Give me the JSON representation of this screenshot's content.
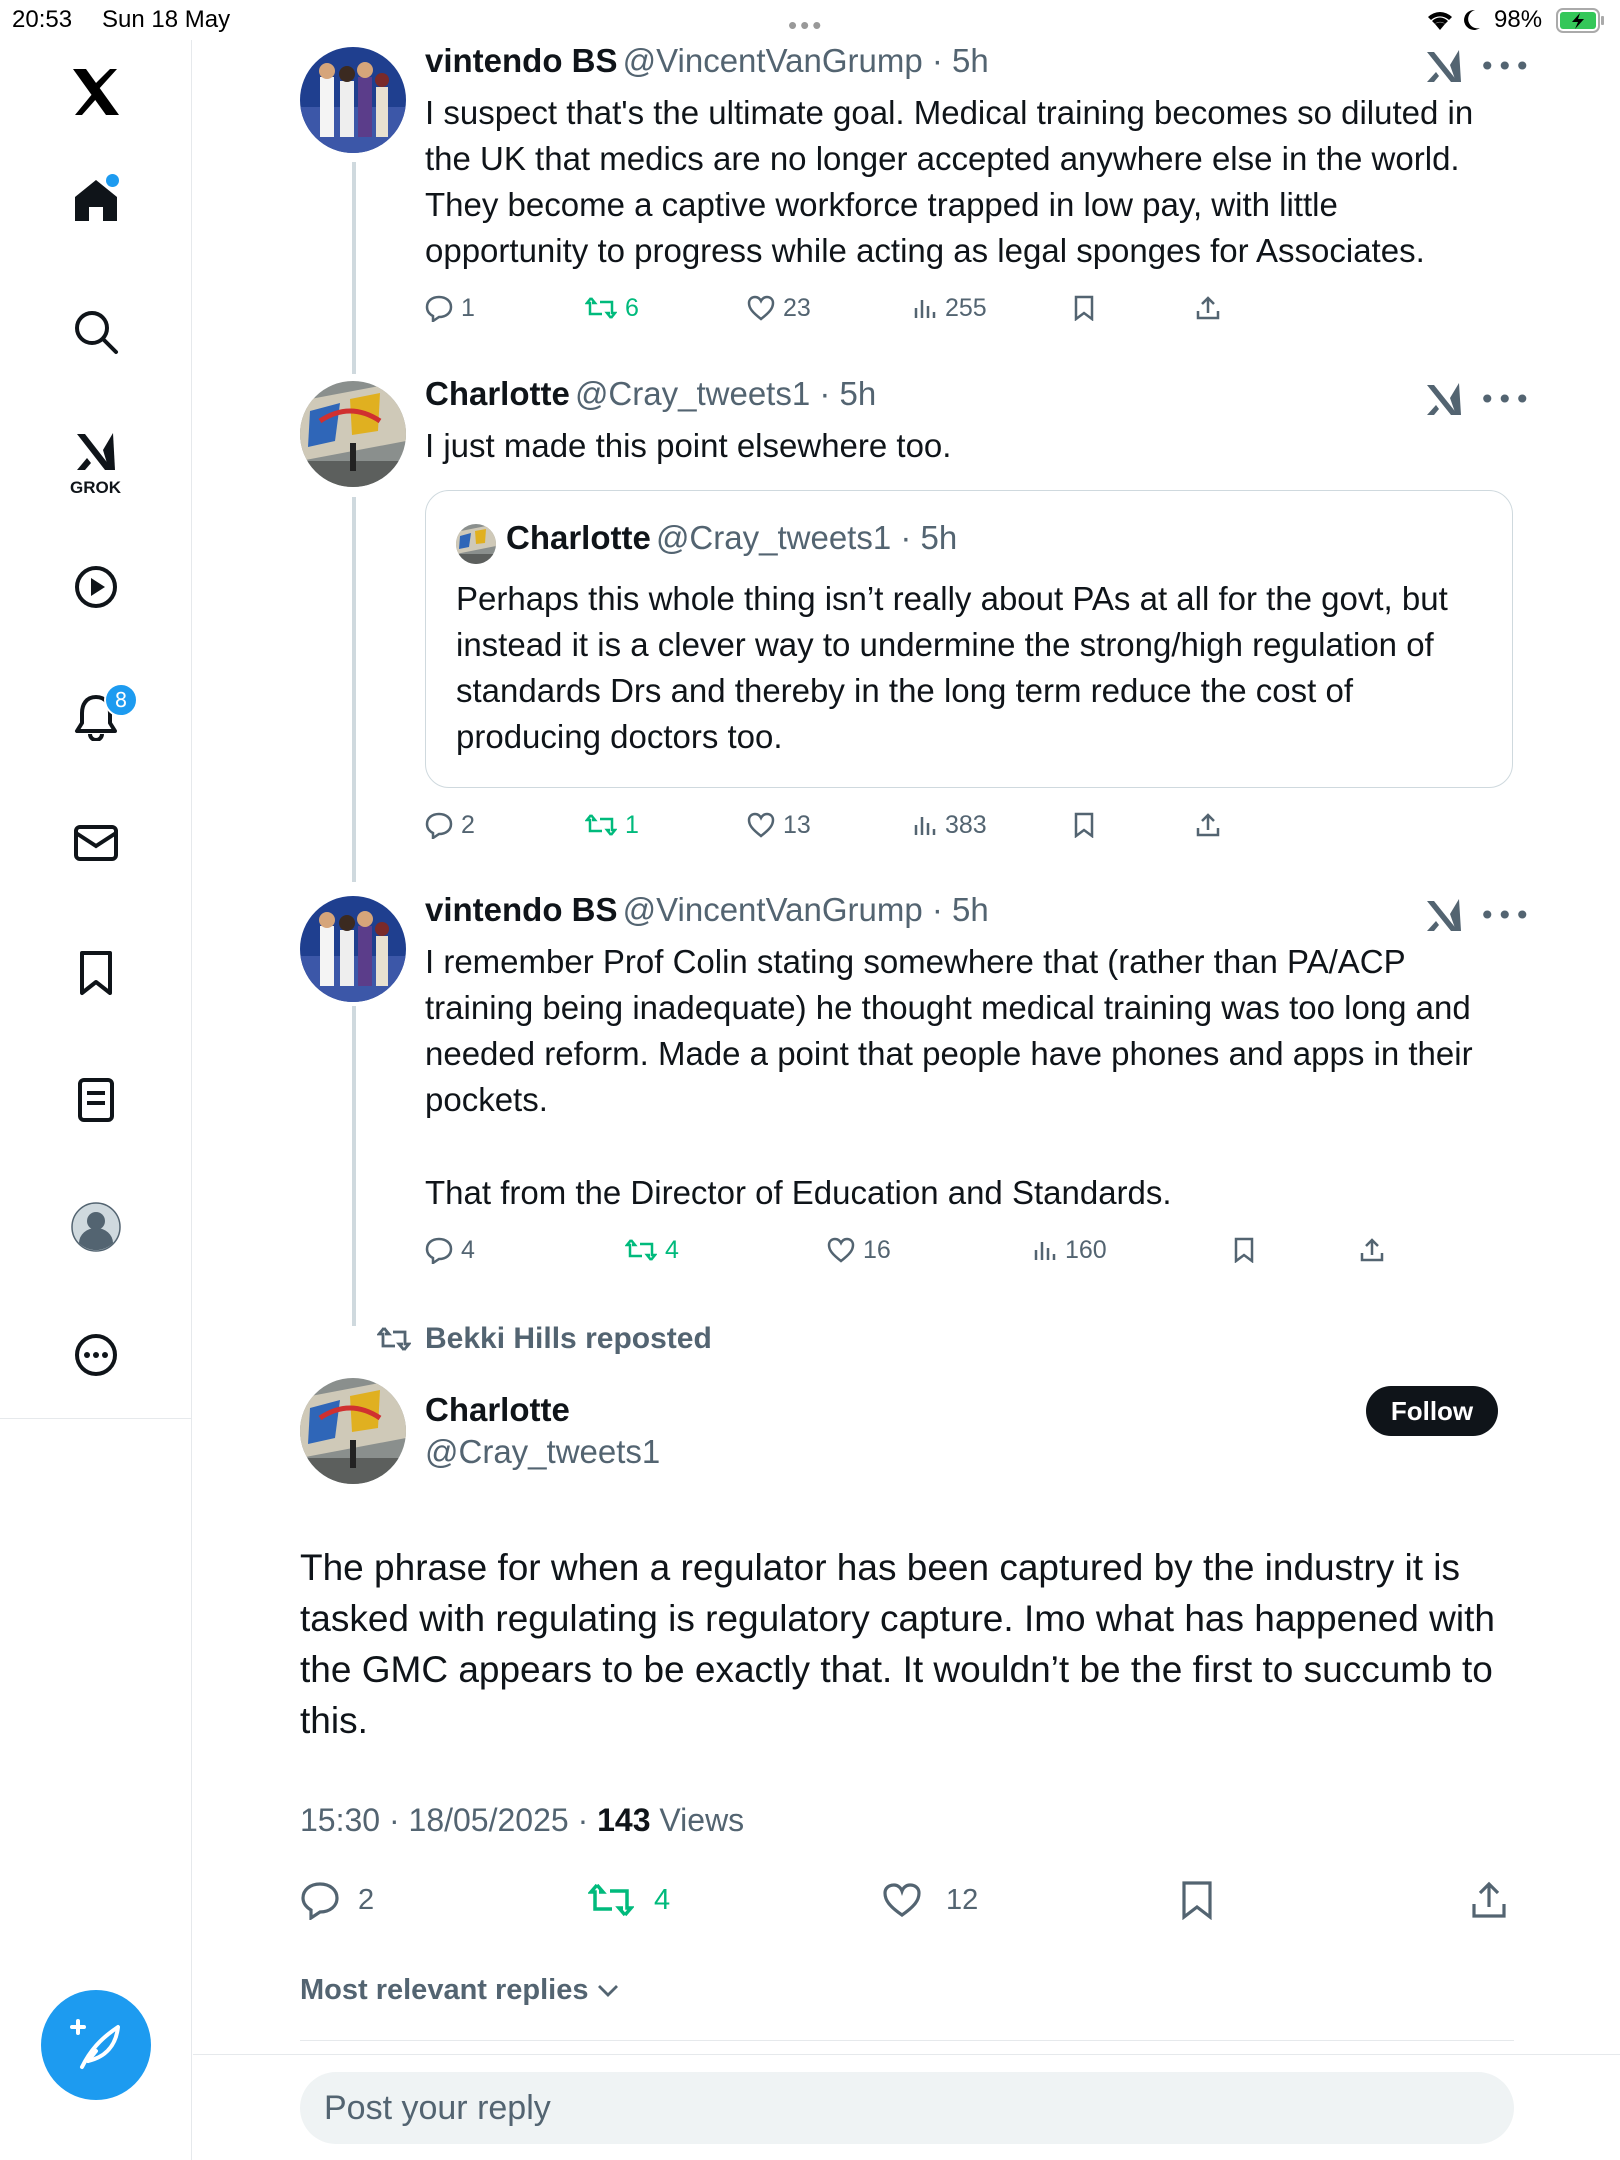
{
  "status_bar": {
    "time": "20:53",
    "date": "Sun 18 May",
    "battery": "98%"
  },
  "sidebar": {
    "grok_label": "GROK",
    "notification_count": "8"
  },
  "tweets": [
    {
      "name": "vintendo BS",
      "handle": "@VincentVanGrump",
      "time": "5h",
      "text": "I suspect that's the ultimate goal. Medical training becomes so diluted in the UK that medics are no longer accepted anywhere else in the world. They become a captive workforce trapped in low pay, with little opportunity to progress while acting as legal sponges for Associates.",
      "replies": "1",
      "reposts": "6",
      "likes": "23",
      "views": "255"
    },
    {
      "name": "Charlotte",
      "handle": "@Cray_tweets1",
      "time": "5h",
      "text": "I just made this point elsewhere too.",
      "quote": {
        "name": "Charlotte",
        "handle": "@Cray_tweets1",
        "time": "5h",
        "text": "Perhaps this whole thing isn’t really about PAs at all for the govt, but instead it is a clever way to undermine the strong/high regulation of standards Drs and thereby in the long term reduce the cost of producing doctors too."
      },
      "replies": "2",
      "reposts": "1",
      "likes": "13",
      "views": "383"
    },
    {
      "name": "vintendo BS",
      "handle": "@VincentVanGrump",
      "time": "5h",
      "text": "I remember Prof Colin stating somewhere that (rather than PA/ACP training being inadequate) he thought medical training was too long and needed reform. Made a point that people have phones and apps in their pockets.",
      "text2": "That from the Director of Education and Standards.",
      "replies": "4",
      "reposts": "4",
      "likes": "16",
      "views": "160"
    }
  ],
  "main_tweet": {
    "reposted_by": "Bekki Hills reposted",
    "name": "Charlotte",
    "handle": "@Cray_tweets1",
    "follow_label": "Follow",
    "text": "The phrase for when a regulator has been captured by the industry it is tasked with regulating is regulatory capture. Imo what has happened with the GMC appears to be exactly that. It wouldn’t be the first to succumb to this.",
    "time": "15:30",
    "date": "18/05/2025",
    "views_count": "143",
    "views_label": "Views",
    "replies": "2",
    "reposts": "4",
    "likes": "12"
  },
  "replies_sort": "Most relevant replies",
  "reply_placeholder": "Post your reply",
  "colors": {
    "accent": "#1d9bf0",
    "repost": "#00ba7c",
    "muted": "#536471",
    "text": "#0f1419"
  }
}
